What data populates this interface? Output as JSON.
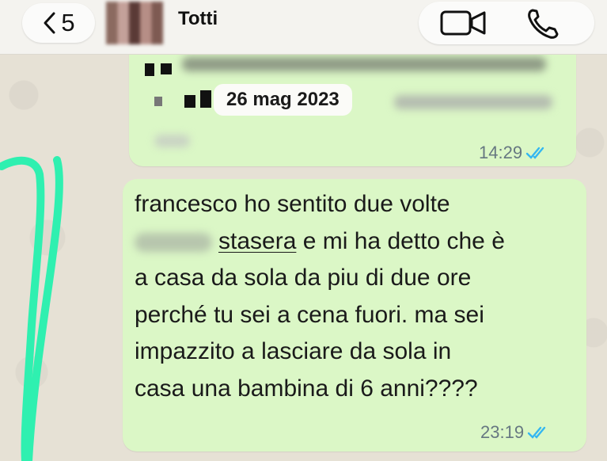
{
  "header": {
    "back_count": "5",
    "contact_name": "Totti",
    "icons": {
      "back": "chevron-left-icon",
      "video": "video-call-icon",
      "phone": "phone-call-icon"
    }
  },
  "messages": [
    {
      "date_label": "26 mag 2023",
      "time": "14:29",
      "status": "read"
    },
    {
      "line1": "francesco ho sentito due volte",
      "line2_word": "stasera",
      "line2_rest": " e mi ha detto che è",
      "line3": "a casa da sola da piu di due ore",
      "line4": "perché tu sei a cena fuori. ma sei",
      "line5": "impazzito a lasciare da sola in",
      "line6": "casa una bambina di 6 anni????",
      "time": "23:19",
      "status": "read"
    }
  ],
  "colors": {
    "bubble": "#dbf7c6",
    "read_ticks": "#34b7f1",
    "annotation": "#2ff0b0"
  }
}
